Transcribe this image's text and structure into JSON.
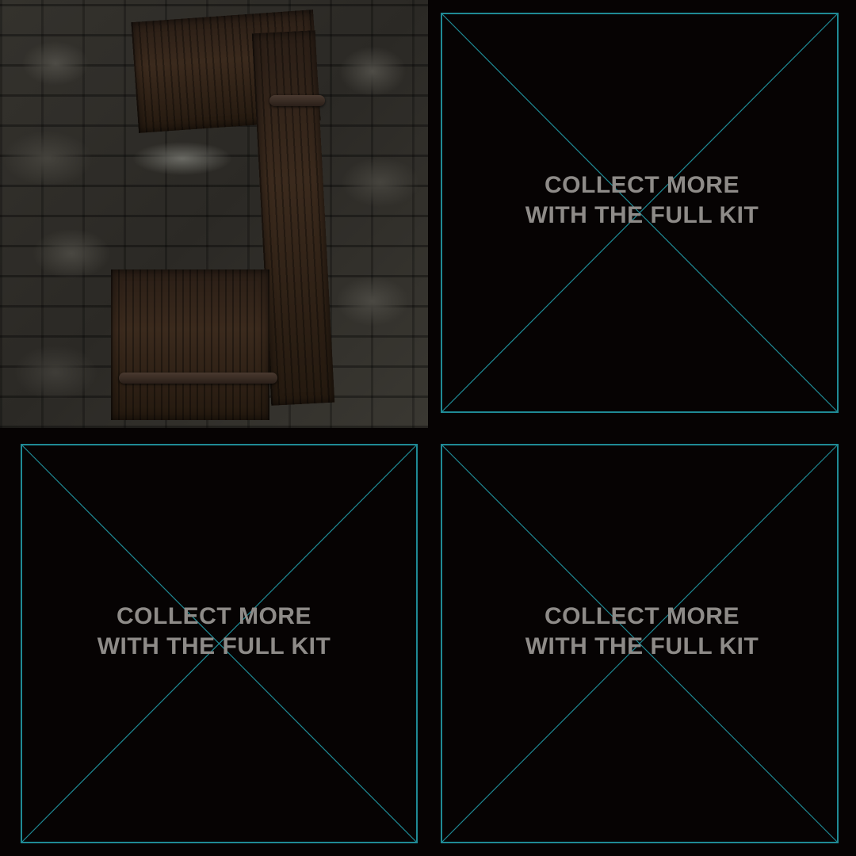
{
  "texture_tile": {
    "description_icon": "stone-wall-door-texture"
  },
  "placeholders": [
    {
      "line1": "COLLECT MORE",
      "line2": "WITH THE FULL KIT"
    },
    {
      "line1": "COLLECT MORE",
      "line2": "WITH THE FULL KIT"
    },
    {
      "line1": "COLLECT MORE",
      "line2": "WITH THE FULL KIT"
    }
  ],
  "colors": {
    "background": "#060303",
    "frame": "#1f8a95",
    "text": "#8e8b88"
  }
}
